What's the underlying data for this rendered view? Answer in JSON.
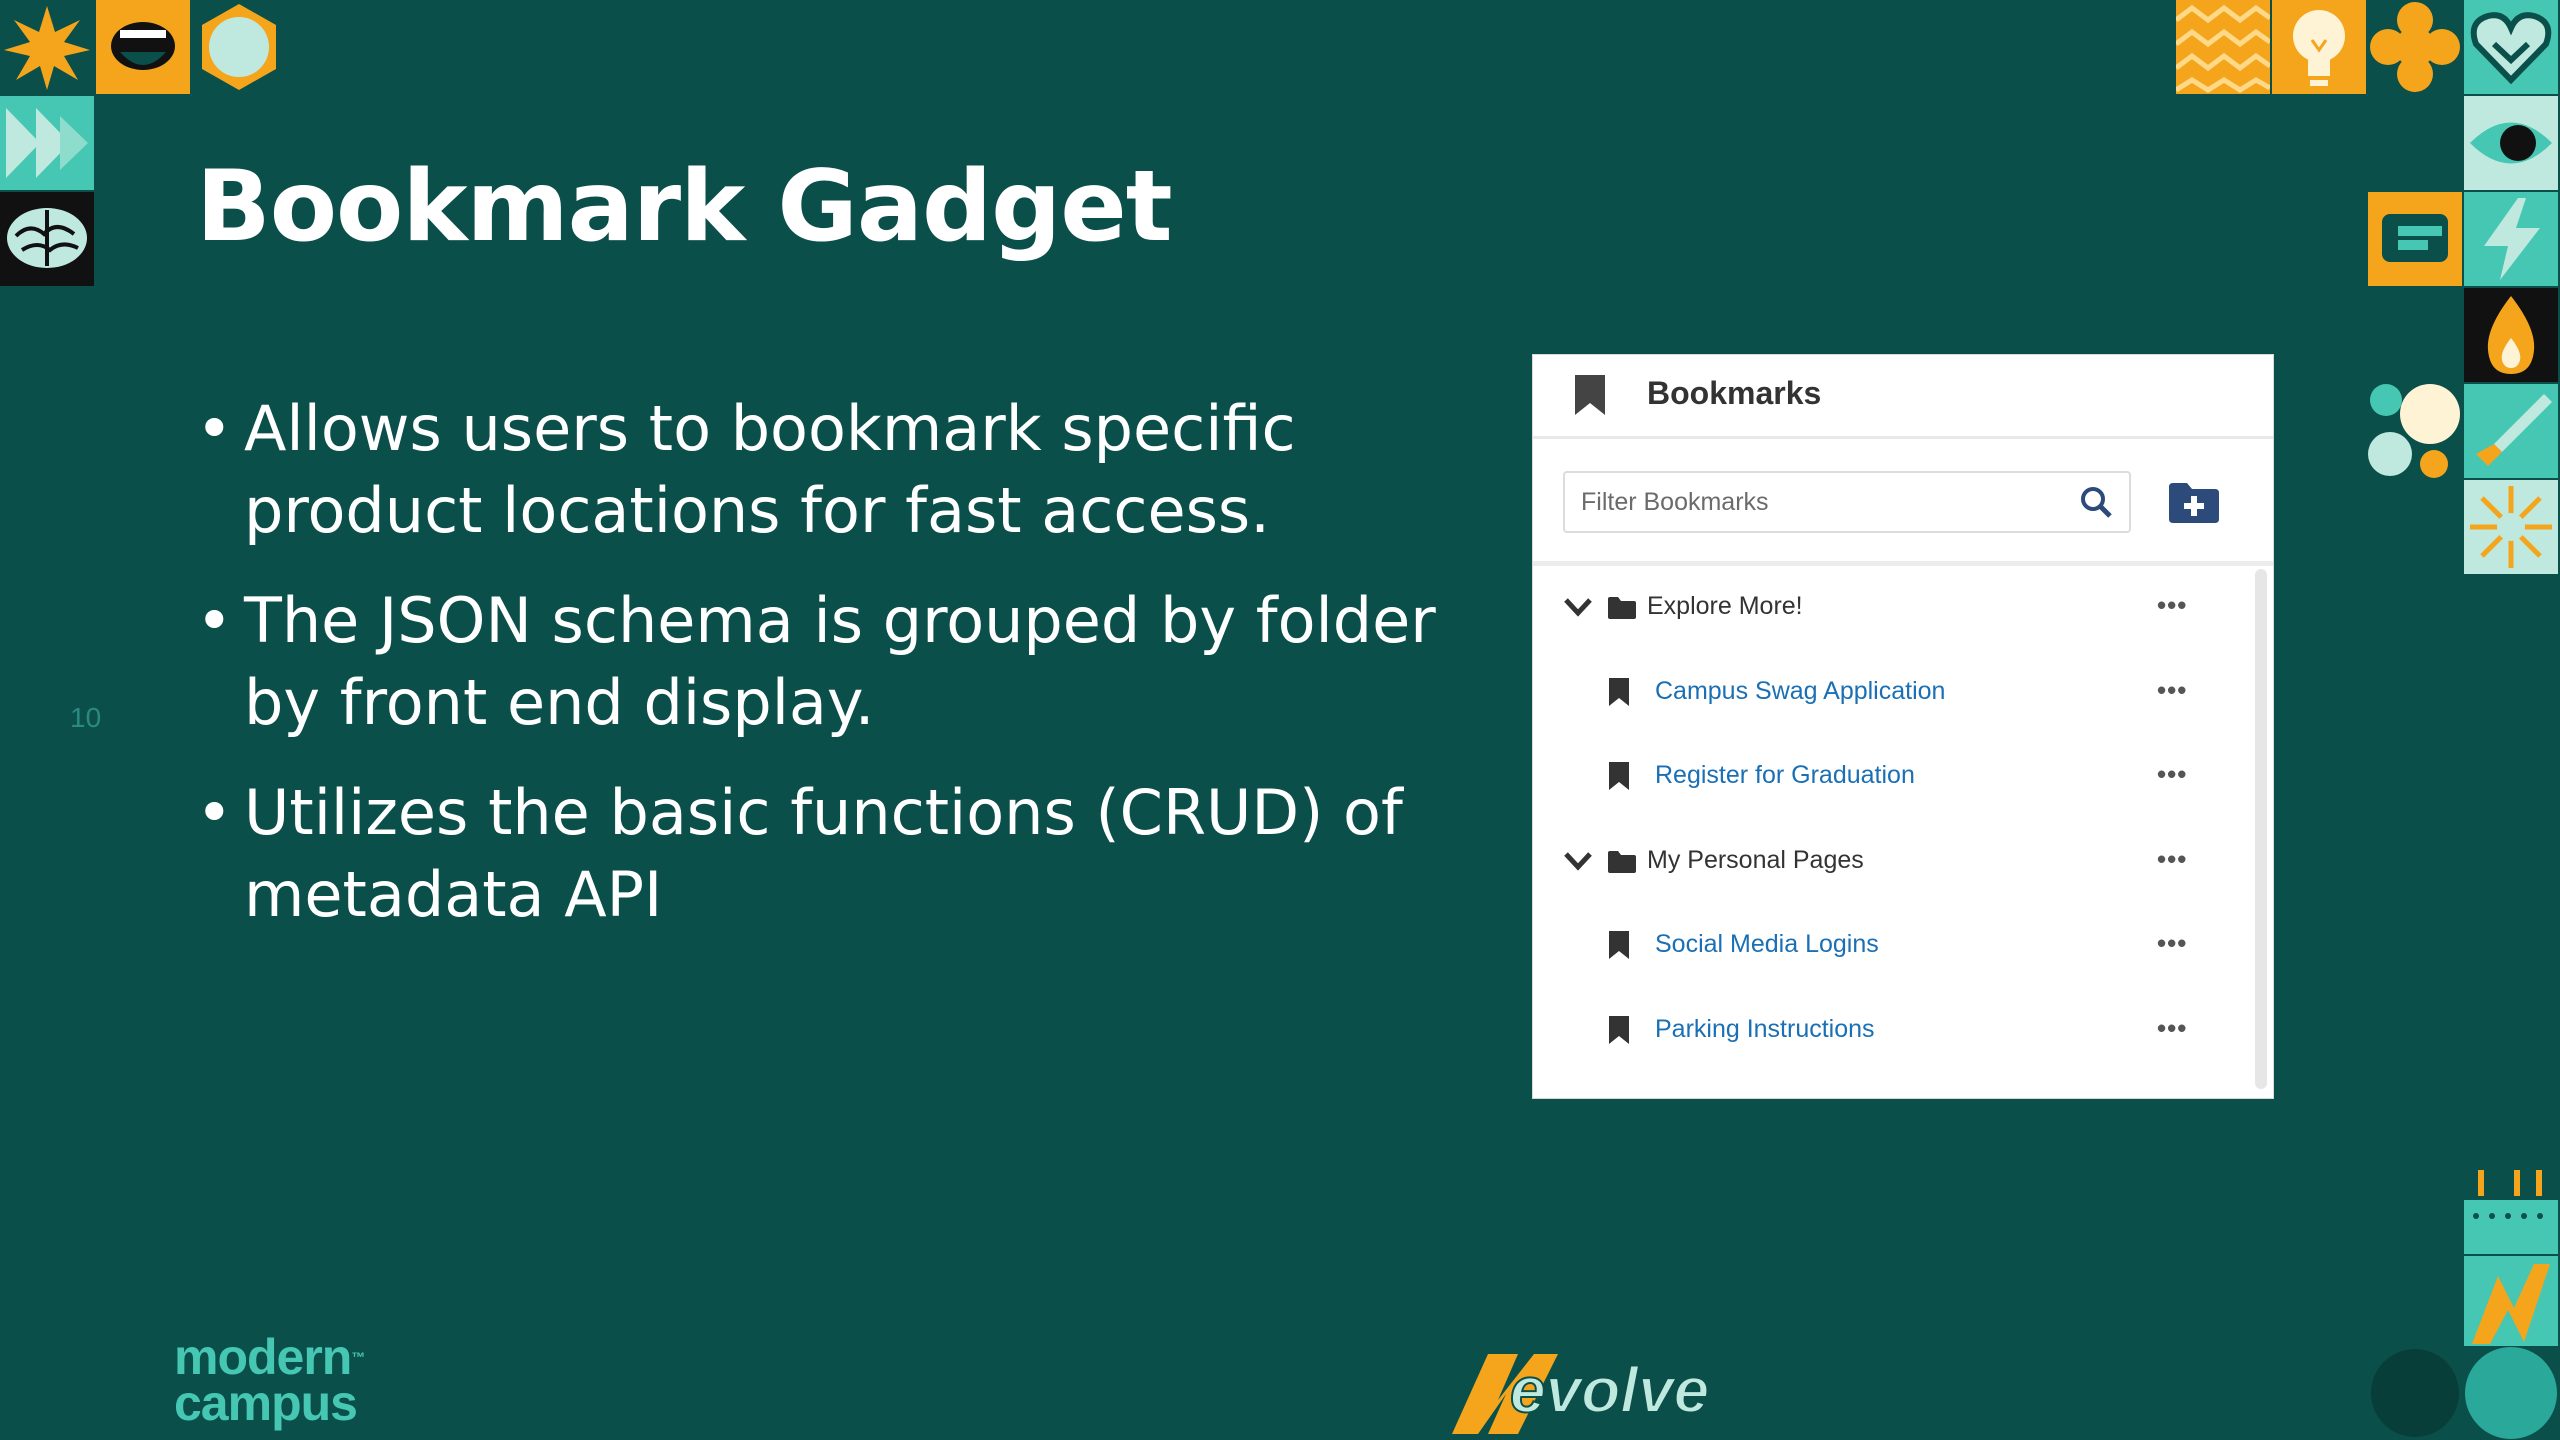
{
  "slide": {
    "title": "Bookmark Gadget",
    "bullets": [
      "Allows users to bookmark specific product locations for fast access.",
      "The JSON schema is grouped by folder by front end display.",
      "Utilizes the basic functions (CRUD) of metadata API"
    ],
    "page_number": "10"
  },
  "panel": {
    "title": "Bookmarks",
    "header_icon": "bookmark-icon",
    "filter_placeholder": "Filter Bookmarks",
    "filter_value": "",
    "add_button_icon": "add-folder-icon",
    "more_label": "•••",
    "items": [
      {
        "type": "folder",
        "label": "Explore More!",
        "expanded": true
      },
      {
        "type": "bookmark",
        "label": "Campus Swag Application"
      },
      {
        "type": "bookmark",
        "label": "Register for Graduation"
      },
      {
        "type": "folder",
        "label": "My Personal Pages",
        "expanded": true
      },
      {
        "type": "bookmark",
        "label": "Social Media Logins"
      },
      {
        "type": "bookmark",
        "label": "Parking Instructions"
      }
    ]
  },
  "logos": {
    "modern_campus_line1": "modern",
    "modern_campus_line2": "campus",
    "modern_campus_tm": "™",
    "evolve": "evolve"
  },
  "colors": {
    "background": "#0b4f4a",
    "teal": "#45c7b3",
    "amber": "#f4a51c",
    "link": "#1a6fb5",
    "navy": "#2c4a7a"
  }
}
